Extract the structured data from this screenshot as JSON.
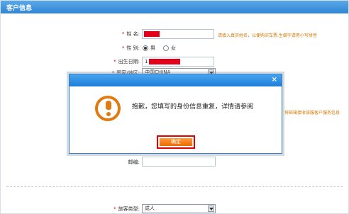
{
  "header": {
    "title": "客户信息"
  },
  "form": {
    "name": {
      "label": "姓  名:",
      "hint": "请填入真实姓名，以便购买车票,生僻字请用小写拼音"
    },
    "gender": {
      "label": "性  别:",
      "option_male": "男",
      "option_female": "女",
      "selected": "男"
    },
    "birthdate": {
      "label": "出生日期:",
      "value_prefix": "1"
    },
    "country": {
      "label": "国家/地区:",
      "value": "中国CHINA"
    },
    "email": {
      "label": "邮编:"
    },
    "right_hint": "将邮箱接收旅服客户服务信息",
    "passenger_type": {
      "label": "旅客类型:",
      "value": "成人"
    }
  },
  "dialog": {
    "close_label": "×",
    "message": "抱歉，您填写的身份信息重复，详情请参阅",
    "ok_label": "确定"
  },
  "colors": {
    "accent": "#2f86d6",
    "warning": "#e07b12",
    "highlight": "#e30000"
  }
}
